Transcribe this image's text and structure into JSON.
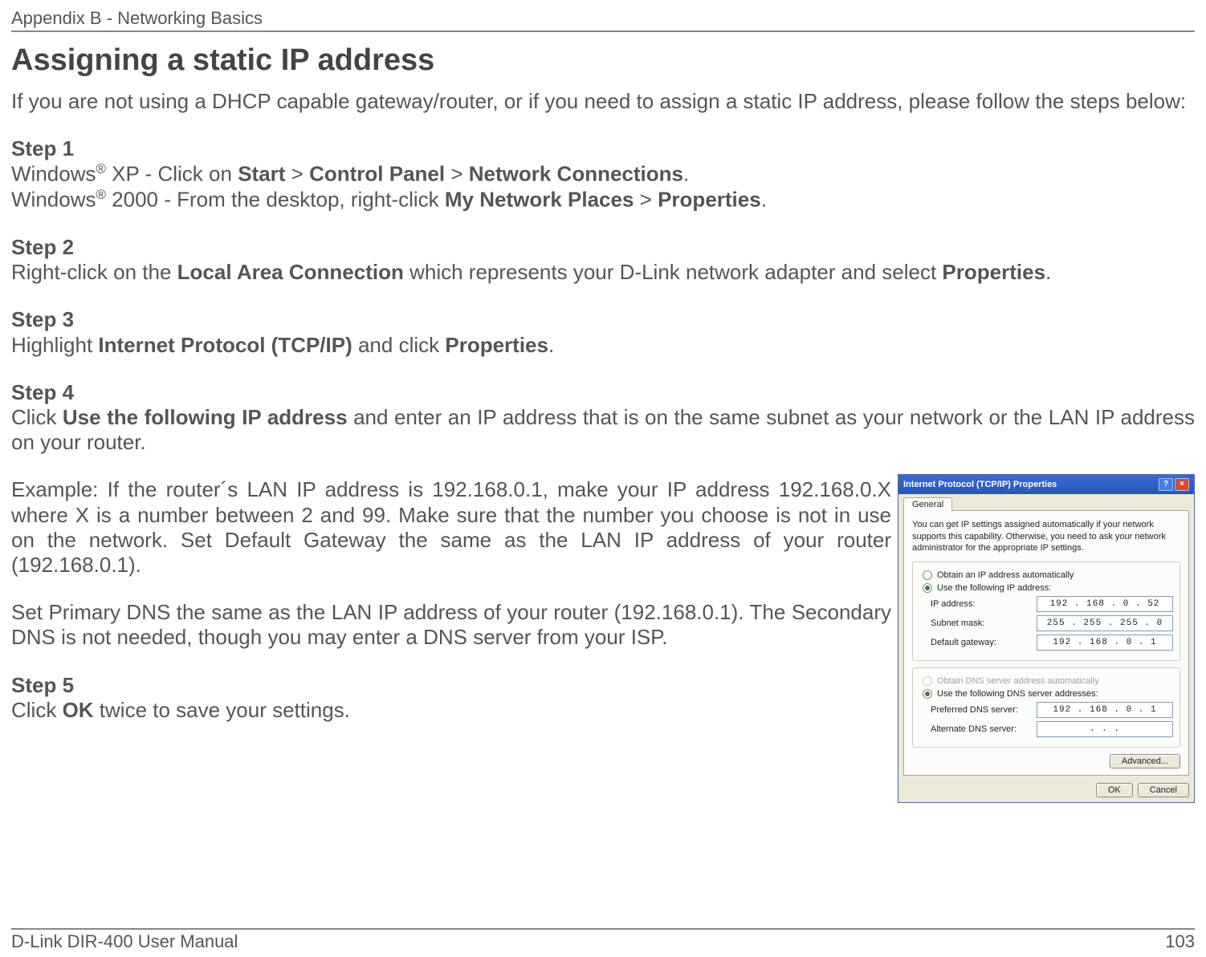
{
  "header": {
    "section": "Appendix B - Networking Basics"
  },
  "title": "Assigning a static IP address",
  "intro": "If you are not using a DHCP capable gateway/router, or if you need to assign a static IP address, please follow the steps below:",
  "step1": {
    "label": "Step 1",
    "xp_prefix": "Windows",
    "xp_reg": "®",
    "xp_mid": " XP - Click on ",
    "xp_start": "Start",
    "gt1": " > ",
    "xp_cp": "Control Panel",
    "gt2": " > ",
    "xp_nc": "Network Connections",
    "xp_period": ".",
    "w2k_prefix": "Windows",
    "w2k_reg": "®",
    "w2k_mid": " 2000 - From the desktop, right-click ",
    "w2k_mnp": "My Network Places",
    "gt3": " > ",
    "w2k_prop": "Properties",
    "w2k_period": "."
  },
  "step2": {
    "label": "Step 2",
    "pre": "Right-click on the ",
    "bold": "Local Area Connection",
    "mid": " which represents your D-Link network adapter and select ",
    "bold2": "Properties",
    "period": "."
  },
  "step3": {
    "label": "Step 3",
    "pre": "Highlight ",
    "bold": "Internet Protocol (TCP/IP)",
    "mid": " and click ",
    "bold2": "Properties",
    "period": "."
  },
  "step4": {
    "label": "Step 4",
    "pre": "Click ",
    "bold": "Use the following IP address",
    "rest": " and enter an IP address that is on the same subnet as your network or the LAN IP address on your router."
  },
  "example": "Example: If the router´s LAN IP address is 192.168.0.1, make your IP address 192.168.0.X where X is a number between 2 and 99. Make sure that the number you choose is not in use on the network. Set Default Gateway the same as the LAN IP address of your router (192.168.0.1).",
  "dns_text": "Set Primary DNS the same as the LAN IP address of your router (192.168.0.1). The Secondary DNS is not needed, though you may enter a DNS server from your ISP.",
  "step5": {
    "label": "Step 5",
    "pre": "Click ",
    "bold": "OK",
    "rest": " twice to save your settings."
  },
  "dialog": {
    "title": "Internet Protocol (TCP/IP) Properties",
    "help": "?",
    "close": "×",
    "tab": "General",
    "info": "You can get IP settings assigned automatically if your network supports this capability. Otherwise, you need to ask your network administrator for the appropriate IP settings.",
    "radio1": "Obtain an IP address automatically",
    "radio2": "Use the following IP address:",
    "ip_label": "IP address:",
    "ip_value": "192 . 168 .  0  .  52",
    "subnet_label": "Subnet mask:",
    "subnet_value": "255 . 255 . 255 .  0",
    "gateway_label": "Default gateway:",
    "gateway_value": "192 . 168 .  0  .   1",
    "radio3": "Obtain DNS server address automatically",
    "radio4": "Use the following DNS server addresses:",
    "pdns_label": "Preferred DNS server:",
    "pdns_value": "192 . 168 .  0  .   1",
    "adns_label": "Alternate DNS server:",
    "adns_value": ".       .       .",
    "advanced": "Advanced...",
    "ok": "OK",
    "cancel": "Cancel"
  },
  "footer": {
    "left": "D-Link DIR-400 User Manual",
    "right": "103"
  }
}
